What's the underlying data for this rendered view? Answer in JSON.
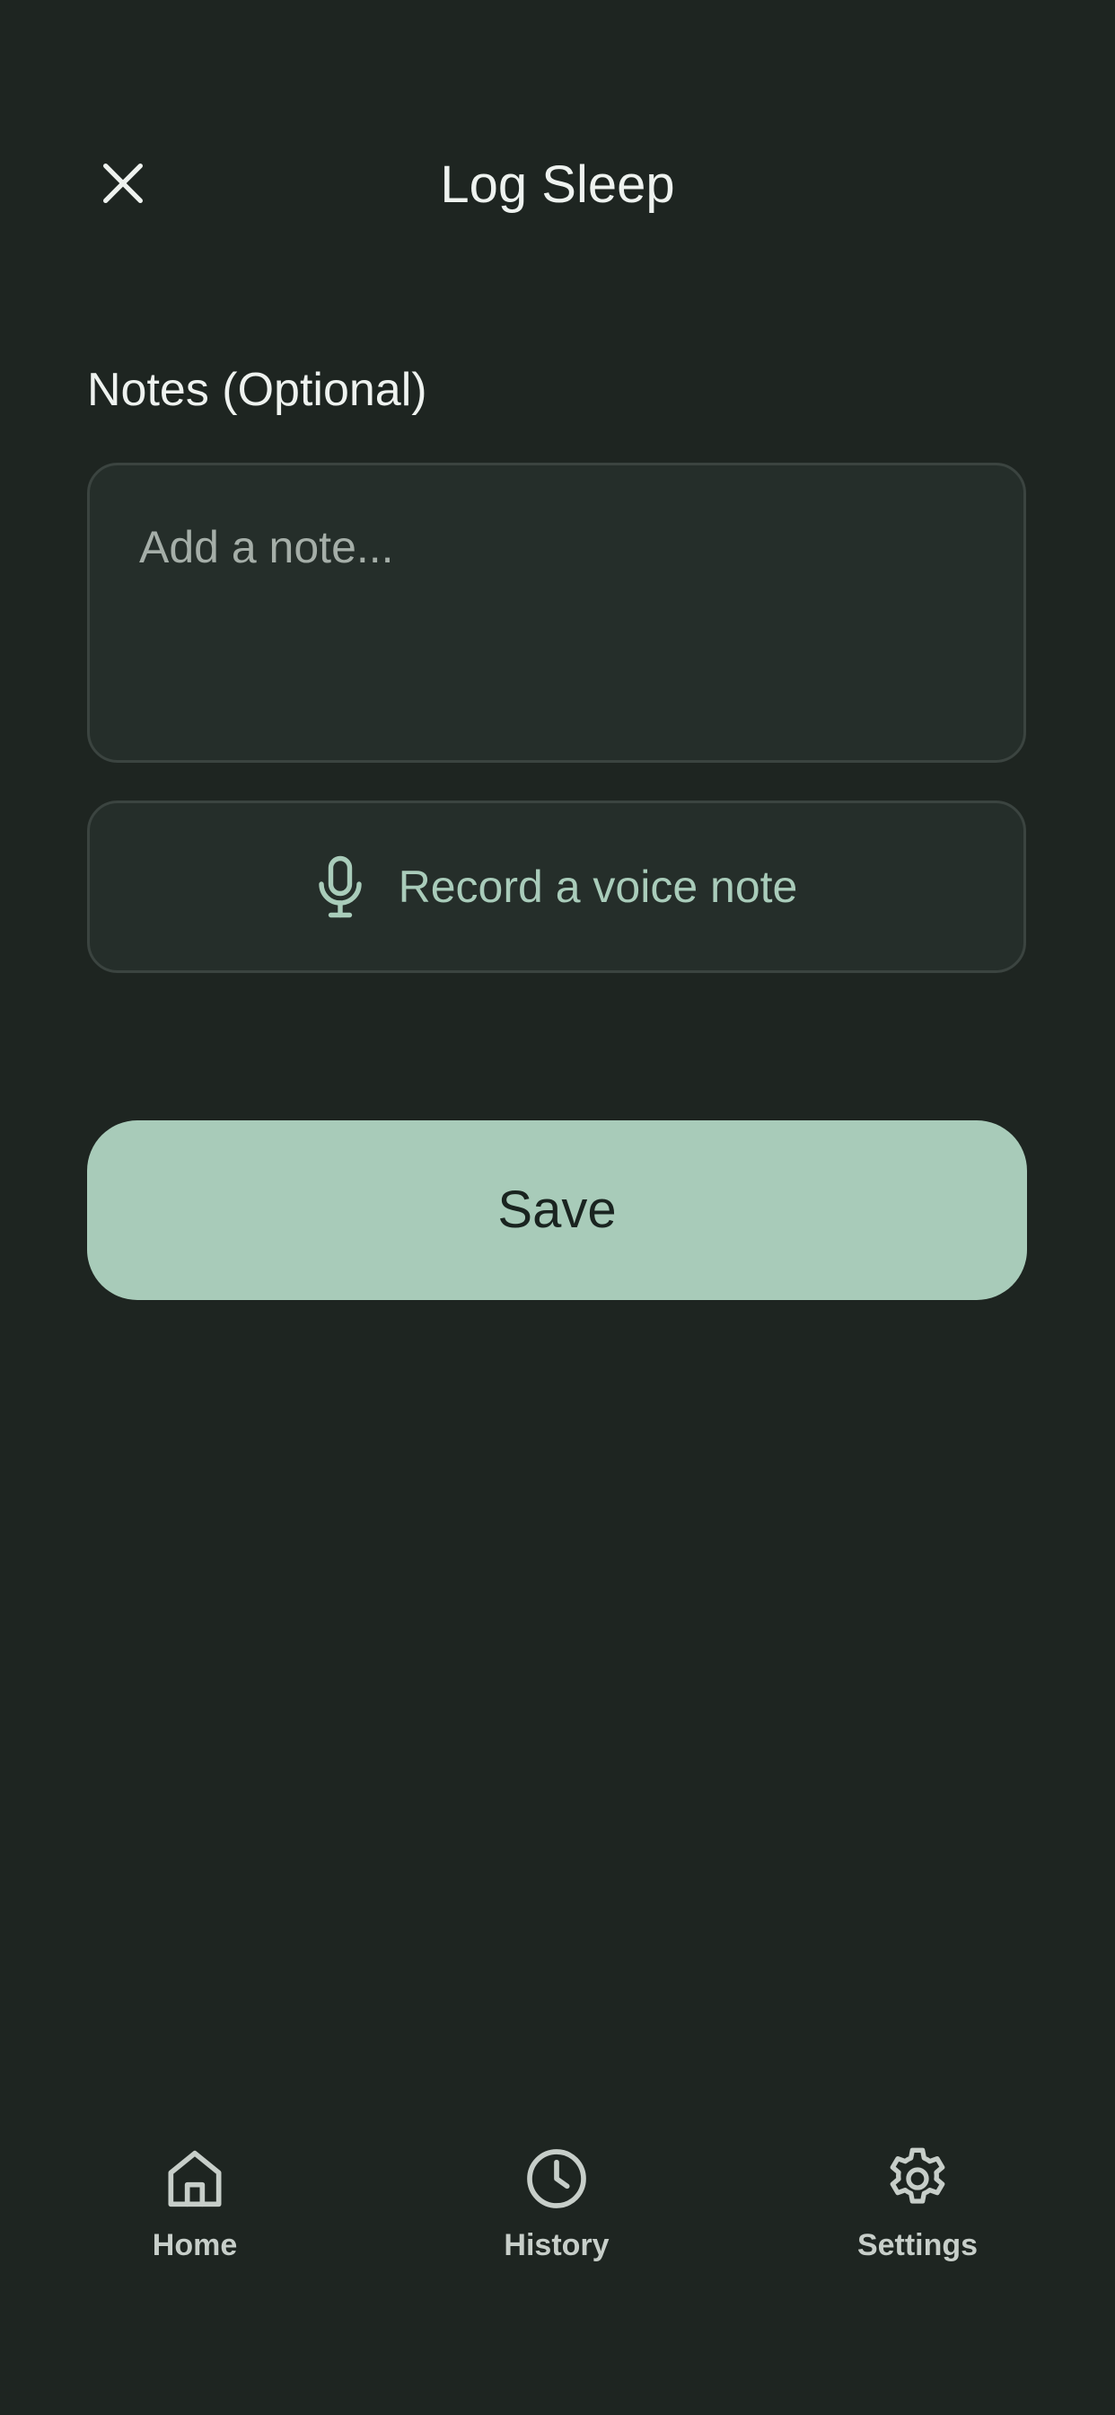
{
  "header": {
    "title": "Log Sleep",
    "close_icon": "close-icon"
  },
  "notes": {
    "label": "Notes (Optional)",
    "placeholder": "Add a note...",
    "value": ""
  },
  "voice_note": {
    "label": "Record a voice note",
    "icon": "microphone-icon"
  },
  "save": {
    "label": "Save"
  },
  "bottom_nav": {
    "items": [
      {
        "label": "Home",
        "icon": "home-icon"
      },
      {
        "label": "History",
        "icon": "clock-icon"
      },
      {
        "label": "Settings",
        "icon": "gear-icon"
      }
    ]
  },
  "colors": {
    "background": "#1e2521",
    "surface": "#252e2a",
    "accent": "#a8cbb9",
    "text_primary": "#eef2ef",
    "text_accent": "#a9ccba"
  }
}
